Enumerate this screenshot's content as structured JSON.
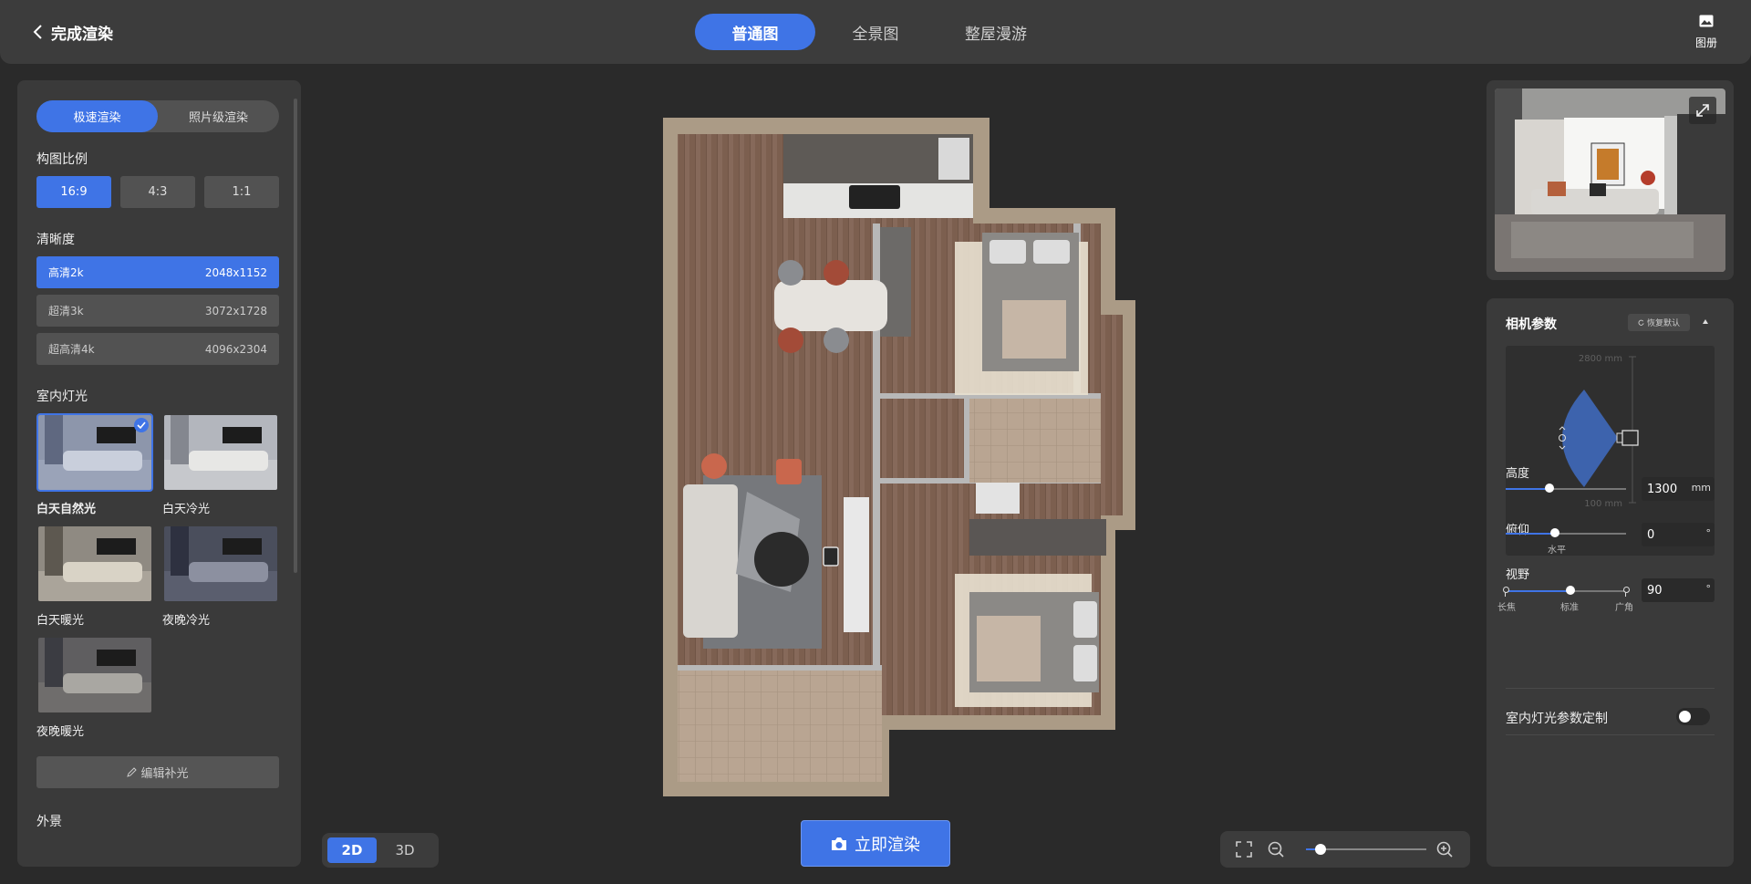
{
  "header": {
    "back_label": "完成渲染",
    "tabs": [
      {
        "label": "普通图",
        "active": true
      },
      {
        "label": "全景图",
        "active": false
      },
      {
        "label": "整屋漫游",
        "active": false
      }
    ],
    "album_label": "图册"
  },
  "left_panel": {
    "render_modes": [
      {
        "label": "极速渲染",
        "active": true
      },
      {
        "label": "照片级渲染",
        "active": false
      }
    ],
    "ratio_title": "构图比例",
    "ratios": [
      {
        "label": "16:9",
        "active": true
      },
      {
        "label": "4:3",
        "active": false
      },
      {
        "label": "1:1",
        "active": false
      }
    ],
    "resolution_title": "清晰度",
    "resolutions": [
      {
        "name": "高清2k",
        "size": "2048x1152",
        "active": true
      },
      {
        "name": "超清3k",
        "size": "3072x1728",
        "active": false
      },
      {
        "name": "超高清4k",
        "size": "4096x2304",
        "active": false
      }
    ],
    "lighting_title": "室内灯光",
    "lighting_options": [
      {
        "label": "白天自然光",
        "selected": true
      },
      {
        "label": "白天冷光",
        "selected": false
      },
      {
        "label": "白天暖光",
        "selected": false
      },
      {
        "label": "夜晚冷光",
        "selected": false
      },
      {
        "label": "夜晚暖光",
        "selected": false
      }
    ],
    "edit_fill_light_label": "编辑补光",
    "exterior_title": "外景"
  },
  "bottom": {
    "view_modes": [
      {
        "label": "2D",
        "active": true
      },
      {
        "label": "3D",
        "active": false
      }
    ],
    "render_button_label": "立即渲染",
    "zoom_fraction": 0.12
  },
  "right_panel": {
    "camera_title": "相机参数",
    "reset_label": "恢复默认",
    "camera_view": {
      "max_label": "2800 mm",
      "min_label": "100 mm"
    },
    "height": {
      "label": "高度",
      "value": "1300",
      "unit": "mm",
      "fraction": 0.36
    },
    "pitch": {
      "label": "俯仰",
      "value": "0",
      "unit": "°",
      "fraction": 0.41,
      "mark_label": "水平"
    },
    "fov": {
      "label": "视野",
      "value": "90",
      "unit": "°",
      "fraction": 0.54,
      "marks": [
        "长焦",
        "标准",
        "广角"
      ]
    },
    "custom_light_label": "室内灯光参数定制",
    "custom_light_enabled": false
  },
  "colors": {
    "accent": "#3f74e6",
    "panel": "#3a3a3a",
    "background": "#2a2a2a"
  }
}
